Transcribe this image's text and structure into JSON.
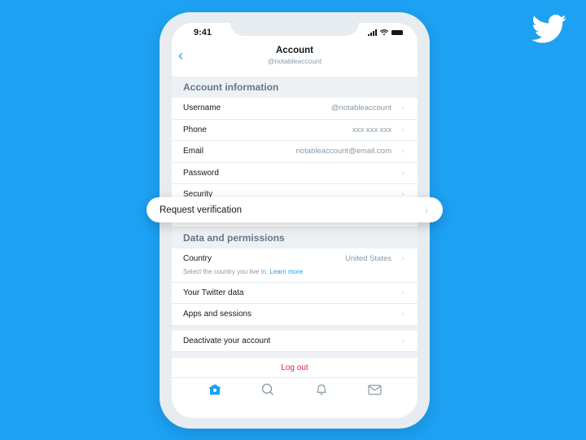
{
  "brand": {
    "logo_icon": "twitter-bird-icon"
  },
  "status_bar": {
    "time": "9:41",
    "icons": [
      "signal-icon",
      "wifi-icon",
      "battery-icon"
    ]
  },
  "header": {
    "back_icon": "chevron-left-icon",
    "back_glyph": "‹",
    "title": "Account",
    "subtitle": "@notableaccount"
  },
  "sections": {
    "account_information": {
      "title": "Account information",
      "rows": [
        {
          "label": "Username",
          "value": "@notableaccount"
        },
        {
          "label": "Phone",
          "value": "xxx xxx xxx"
        },
        {
          "label": "Email",
          "value": "notableaccount@email.com"
        },
        {
          "label": "Password",
          "value": ""
        },
        {
          "label": "Security",
          "value": ""
        }
      ]
    },
    "highlight": {
      "label": "Request verification"
    },
    "data_permissions": {
      "title": "Data and permissions",
      "country": {
        "label": "Country",
        "value": "United States",
        "help": "Select the country you live in.",
        "help_link": "Learn more"
      },
      "rows": [
        {
          "label": "Your Twitter data"
        },
        {
          "label": "Apps and sessions"
        }
      ]
    },
    "deactivate": {
      "label": "Deactivate your account"
    },
    "logout": {
      "label": "Log out"
    }
  },
  "chevron_glyph": "›",
  "tab_bar": {
    "tabs": [
      {
        "name": "home",
        "icon": "home-icon",
        "active": true
      },
      {
        "name": "search",
        "icon": "search-icon",
        "active": false
      },
      {
        "name": "notifications",
        "icon": "bell-icon",
        "active": false
      },
      {
        "name": "messages",
        "icon": "mail-icon",
        "active": false
      }
    ]
  },
  "colors": {
    "background": "#1da1f2",
    "accent": "#1da1f2",
    "logout": "#e0245e",
    "section_bg": "#eef1f4",
    "muted_text": "#8899a6"
  }
}
